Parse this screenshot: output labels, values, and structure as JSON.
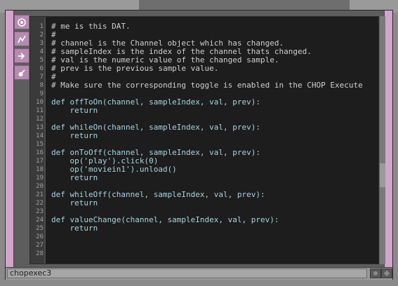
{
  "node": {
    "name": "chopexec3",
    "icons": [
      "viewer-icon",
      "cook-icon",
      "bypass-icon",
      "lock-icon"
    ]
  },
  "code": {
    "lines": [
      {
        "n": "1",
        "text": "# me is this DAT.",
        "kind": "comment"
      },
      {
        "n": "2",
        "text": "#",
        "kind": "comment"
      },
      {
        "n": "3",
        "text": "# channel is the Channel object which has changed.",
        "kind": "comment"
      },
      {
        "n": "4",
        "text": "# sampleIndex is the index of the channel thats changed.",
        "kind": "comment"
      },
      {
        "n": "5",
        "text": "# val is the numeric value of the changed sample.",
        "kind": "comment"
      },
      {
        "n": "6",
        "text": "# prev is the previous sample value.",
        "kind": "comment"
      },
      {
        "n": "7",
        "text": "#",
        "kind": "comment"
      },
      {
        "n": "8",
        "text": "# Make sure the corresponding toggle is enabled in the CHOP Execute",
        "kind": "comment"
      },
      {
        "n": "9",
        "text": "",
        "kind": "code"
      },
      {
        "n": "10",
        "text": "def offToOn(channel, sampleIndex, val, prev):",
        "kind": "code"
      },
      {
        "n": "11",
        "text": "    return",
        "kind": "code"
      },
      {
        "n": "12",
        "text": "",
        "kind": "code"
      },
      {
        "n": "13",
        "text": "def whileOn(channel, sampleIndex, val, prev):",
        "kind": "code"
      },
      {
        "n": "14",
        "text": "    return",
        "kind": "code"
      },
      {
        "n": "15",
        "text": "",
        "kind": "code"
      },
      {
        "n": "16",
        "text": "def onToOff(channel, sampleIndex, val, prev):",
        "kind": "code"
      },
      {
        "n": "17",
        "text": "    op('play').click(0)",
        "kind": "code"
      },
      {
        "n": "18",
        "text": "    op('moviein1').unload()",
        "kind": "code"
      },
      {
        "n": "19",
        "text": "    return",
        "kind": "code"
      },
      {
        "n": "20",
        "text": "",
        "kind": "code"
      },
      {
        "n": "21",
        "text": "def whileOff(channel, sampleIndex, val, prev):",
        "kind": "code"
      },
      {
        "n": "22",
        "text": "    return",
        "kind": "code"
      },
      {
        "n": "23",
        "text": "",
        "kind": "code"
      },
      {
        "n": "24",
        "text": "def valueChange(channel, sampleIndex, val, prev):",
        "kind": "code"
      },
      {
        "n": "25",
        "text": "    return",
        "kind": "code"
      },
      {
        "n": "26",
        "text": "",
        "kind": "code"
      },
      {
        "n": "27",
        "text": "",
        "kind": "code"
      },
      {
        "n": "28",
        "text": "",
        "kind": "code"
      }
    ]
  },
  "colors": {
    "node_accent": "#d3a3cc",
    "editor_bg": "#1d1d1d",
    "code_text": "#a9d4e0",
    "comment_text": "#cfcfcf"
  }
}
